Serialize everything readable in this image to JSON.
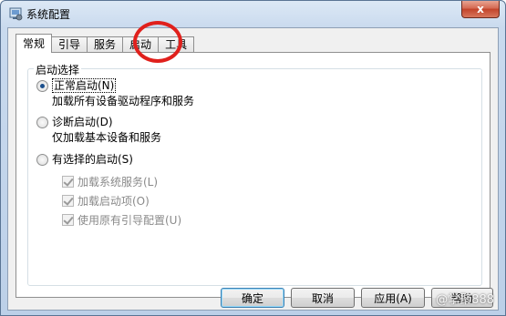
{
  "window": {
    "title": "系统配置",
    "close_label": "x"
  },
  "tabs": [
    {
      "label": "常规",
      "active": true
    },
    {
      "label": "引导",
      "active": false
    },
    {
      "label": "服务",
      "active": false
    },
    {
      "label": "启动",
      "active": false
    },
    {
      "label": "工具",
      "active": false
    }
  ],
  "startup_group": {
    "legend": "启动选择",
    "options": [
      {
        "label": "正常启动(N)",
        "description": "加载所有设备驱动程序和服务",
        "checked": true
      },
      {
        "label": "诊断启动(D)",
        "description": "仅加载基本设备和服务",
        "checked": false
      },
      {
        "label": "有选择的启动(S)",
        "description": "",
        "checked": false
      }
    ],
    "selective_items": [
      {
        "label": "加载系统服务(L)",
        "checked": true,
        "enabled": false
      },
      {
        "label": "加载启动项(O)",
        "checked": true,
        "enabled": false
      },
      {
        "label": "使用原有引导配置(U)",
        "checked": true,
        "enabled": false
      }
    ]
  },
  "buttons": {
    "ok": "确定",
    "cancel": "取消",
    "apply": "应用(A)",
    "help": "帮助"
  },
  "watermark": "@掌聚888",
  "colors": {
    "highlight": "#e0201c",
    "radio_dot": "#1b4f8c"
  }
}
